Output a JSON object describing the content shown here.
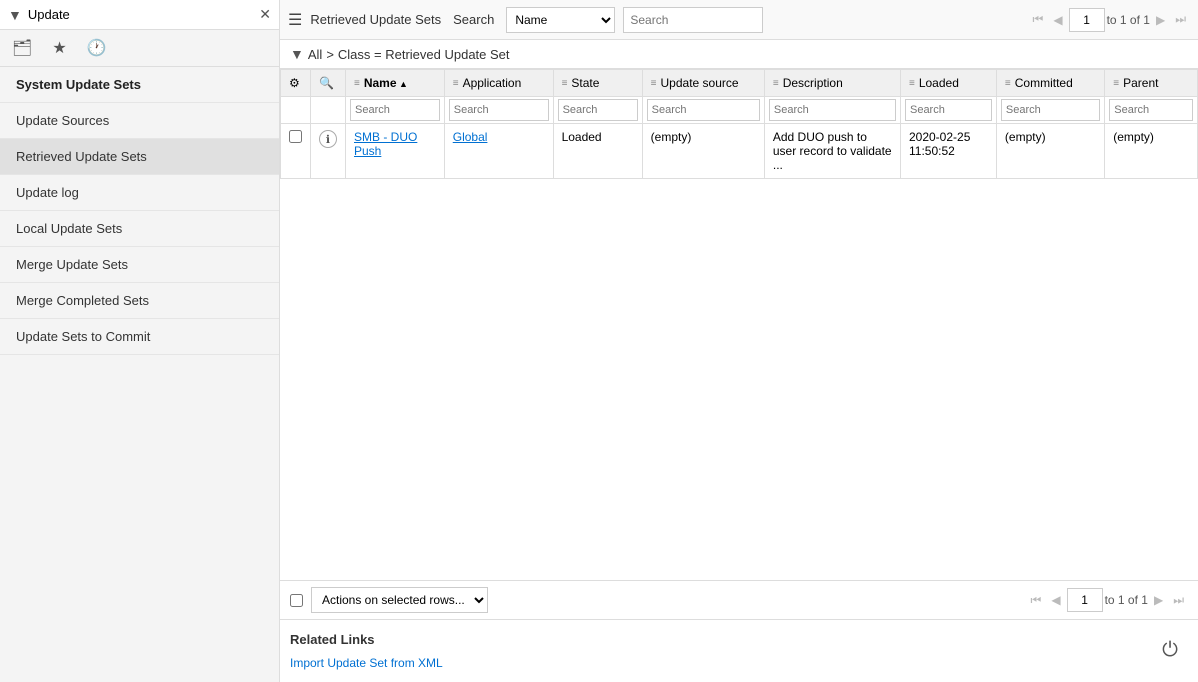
{
  "sidebar": {
    "search_value": "Update",
    "search_placeholder": "Update",
    "icons": [
      "inbox-icon",
      "star-icon",
      "history-icon"
    ],
    "nav_items": [
      {
        "label": "System Update Sets",
        "type": "header"
      },
      {
        "label": "Update Sources",
        "type": "item"
      },
      {
        "label": "Retrieved Update Sets",
        "type": "item",
        "active": true
      },
      {
        "label": "Update log",
        "type": "item"
      },
      {
        "label": "Local Update Sets",
        "type": "item"
      },
      {
        "label": "Merge Update Sets",
        "type": "item"
      },
      {
        "label": "Merge Completed Sets",
        "type": "item"
      },
      {
        "label": "Update Sets to Commit",
        "type": "item"
      }
    ]
  },
  "topbar": {
    "title": "Retrieved Update Sets",
    "search_label": "Search",
    "search_options": [
      "Name",
      "Application",
      "State",
      "Update source",
      "Description",
      "Loaded",
      "Committed",
      "Parent"
    ],
    "search_selected": "Name",
    "search_placeholder": "Search",
    "page_current": "1",
    "page_total": "to 1 of 1"
  },
  "breadcrumb": {
    "all_label": "All",
    "separator": ">",
    "current": "Class = Retrieved Update Set"
  },
  "table": {
    "columns": [
      {
        "id": "name",
        "label": "Name",
        "active": true
      },
      {
        "id": "application",
        "label": "Application"
      },
      {
        "id": "state",
        "label": "State"
      },
      {
        "id": "update_source",
        "label": "Update source"
      },
      {
        "id": "description",
        "label": "Description"
      },
      {
        "id": "loaded",
        "label": "Loaded"
      },
      {
        "id": "committed",
        "label": "Committed"
      },
      {
        "id": "parent",
        "label": "Parent"
      }
    ],
    "search_placeholders": [
      "Search",
      "Search",
      "Search",
      "Search",
      "Search",
      "Search",
      "Search",
      "Search"
    ],
    "rows": [
      {
        "name": "SMB - DUO Push",
        "name_link": true,
        "application": "Global",
        "application_link": true,
        "state": "Loaded",
        "update_source": "(empty)",
        "description": "Add DUO push to user record to validate ...",
        "loaded": "2020-02-25 11:50:52",
        "committed": "(empty)",
        "parent": "(empty)"
      }
    ]
  },
  "bottom_bar": {
    "actions_label": "Actions on selected rows...",
    "page_current": "1",
    "page_total": "to 1 of 1"
  },
  "related_links": {
    "title": "Related Links",
    "links": [
      {
        "label": "Import Update Set from XML",
        "href": "#"
      }
    ]
  },
  "footer": {
    "icon": "⏻"
  }
}
